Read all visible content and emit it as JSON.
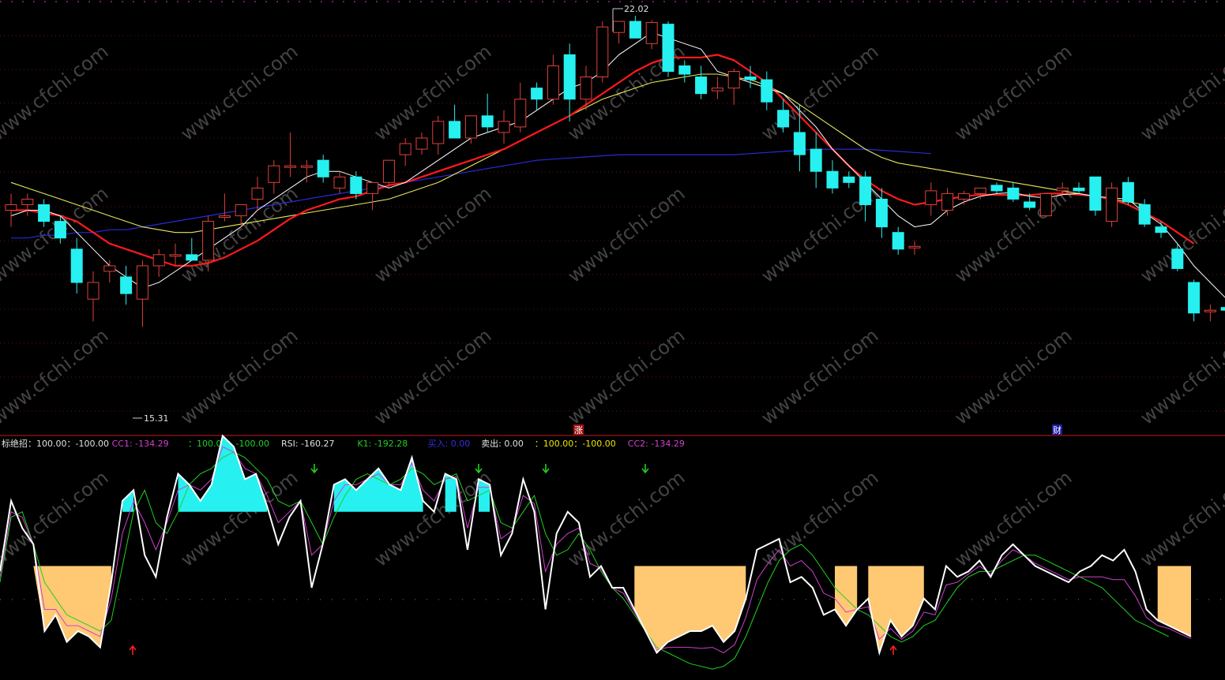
{
  "colors": {
    "up": "#e0403a",
    "down": "#26f0f0",
    "ma5": "#ffffff",
    "ma10": "#ff1a1a",
    "ma20": "#e8e85a",
    "ma60": "#2a2ad8",
    "grid": "#6a0f0f",
    "separator": "#c01818",
    "top_border": "#d040d0",
    "buy_arrow": "#ff2020",
    "sell_arrow": "#20d020",
    "cyan_fill": "#26f0f0",
    "orange_fill": "#ffc873",
    "rsi_line": "#ffffff",
    "k1_line": "#20d020",
    "cc_line": "#d040d0"
  },
  "watermark": "www.cfchi.com",
  "markers": {
    "high_label": "22.02",
    "low_label": "15.31",
    "zhang_badge": "涨",
    "cai_badge": "财"
  },
  "indicator_header": [
    {
      "text": "标绝招：100.00：-100.00",
      "color": "#e0e0e0"
    },
    {
      "text": "CC1: -134.29",
      "color": "#d040d0"
    },
    {
      "text": "：100.00：-100.00",
      "color": "#20d020"
    },
    {
      "text": "RSI: -160.27",
      "color": "#e0e0e0"
    },
    {
      "text": "K1: -192.28",
      "color": "#20d020"
    },
    {
      "text": "买入: 0.00",
      "color": "#3030e0"
    },
    {
      "text": "卖出: 0.00",
      "color": "#e0e0e0"
    },
    {
      "text": "：100.00：-100.00",
      "color": "#e8e800"
    },
    {
      "text": "CC2: -134.29",
      "color": "#d040d0"
    }
  ],
  "chart_data": [
    {
      "type": "candlestick",
      "title": "",
      "ylim": [
        15.0,
        22.3
      ],
      "candles": [
        {
          "o": 18.6,
          "h": 18.9,
          "l": 18.3,
          "c": 18.7
        },
        {
          "o": 18.7,
          "h": 18.9,
          "l": 18.5,
          "c": 18.8
        },
        {
          "o": 18.7,
          "h": 18.8,
          "l": 18.3,
          "c": 18.4
        },
        {
          "o": 18.4,
          "h": 18.5,
          "l": 18.0,
          "c": 18.1
        },
        {
          "o": 17.9,
          "h": 18.1,
          "l": 17.1,
          "c": 17.3
        },
        {
          "o": 17.0,
          "h": 17.5,
          "l": 16.6,
          "c": 17.3
        },
        {
          "o": 17.5,
          "h": 17.7,
          "l": 17.3,
          "c": 17.6
        },
        {
          "o": 17.4,
          "h": 17.6,
          "l": 16.9,
          "c": 17.1
        },
        {
          "o": 17.0,
          "h": 17.7,
          "l": 16.5,
          "c": 17.6
        },
        {
          "o": 17.6,
          "h": 17.9,
          "l": 17.4,
          "c": 17.8
        },
        {
          "o": 17.8,
          "h": 18.0,
          "l": 17.6,
          "c": 17.8
        },
        {
          "o": 17.8,
          "h": 18.1,
          "l": 17.7,
          "c": 17.7
        },
        {
          "o": 17.7,
          "h": 18.5,
          "l": 17.5,
          "c": 18.4
        },
        {
          "o": 18.5,
          "h": 18.9,
          "l": 18.4,
          "c": 18.5
        },
        {
          "o": 18.5,
          "h": 18.7,
          "l": 18.3,
          "c": 18.7
        },
        {
          "o": 18.8,
          "h": 19.2,
          "l": 18.6,
          "c": 19.0
        },
        {
          "o": 19.1,
          "h": 19.5,
          "l": 18.9,
          "c": 19.4
        },
        {
          "o": 19.4,
          "h": 20.0,
          "l": 19.2,
          "c": 19.4
        },
        {
          "o": 19.4,
          "h": 19.5,
          "l": 19.1,
          "c": 19.4
        },
        {
          "o": 19.5,
          "h": 19.6,
          "l": 19.1,
          "c": 19.2
        },
        {
          "o": 19.0,
          "h": 19.3,
          "l": 18.9,
          "c": 19.2
        },
        {
          "o": 19.2,
          "h": 19.3,
          "l": 18.8,
          "c": 18.9
        },
        {
          "o": 18.9,
          "h": 19.0,
          "l": 18.6,
          "c": 19.1
        },
        {
          "o": 19.1,
          "h": 19.5,
          "l": 19.0,
          "c": 19.5
        },
        {
          "o": 19.6,
          "h": 19.9,
          "l": 19.4,
          "c": 19.8
        },
        {
          "o": 19.7,
          "h": 20.0,
          "l": 19.6,
          "c": 19.9
        },
        {
          "o": 19.8,
          "h": 20.3,
          "l": 19.6,
          "c": 20.2
        },
        {
          "o": 20.2,
          "h": 20.5,
          "l": 19.9,
          "c": 19.9
        },
        {
          "o": 19.9,
          "h": 20.3,
          "l": 19.8,
          "c": 20.3
        },
        {
          "o": 20.3,
          "h": 20.7,
          "l": 20.0,
          "c": 20.1
        },
        {
          "o": 20.0,
          "h": 20.4,
          "l": 19.8,
          "c": 20.2
        },
        {
          "o": 20.1,
          "h": 20.9,
          "l": 20.0,
          "c": 20.6
        },
        {
          "o": 20.8,
          "h": 20.9,
          "l": 20.4,
          "c": 20.6
        },
        {
          "o": 20.6,
          "h": 21.4,
          "l": 20.5,
          "c": 21.2
        },
        {
          "o": 21.4,
          "h": 21.6,
          "l": 20.2,
          "c": 20.6
        },
        {
          "o": 20.6,
          "h": 21.2,
          "l": 20.4,
          "c": 21.0
        },
        {
          "o": 21.0,
          "h": 22.0,
          "l": 20.9,
          "c": 21.9
        },
        {
          "o": 21.8,
          "h": 22.0,
          "l": 21.6,
          "c": 22.0
        },
        {
          "o": 22.0,
          "h": 22.1,
          "l": 21.9,
          "c": 21.7
        },
        {
          "o": 21.6,
          "h": 22.02,
          "l": 21.5,
          "c": 21.98
        },
        {
          "o": 21.95,
          "h": 22.0,
          "l": 21.0,
          "c": 21.1
        },
        {
          "o": 21.2,
          "h": 21.3,
          "l": 20.9,
          "c": 21.05
        },
        {
          "o": 21.0,
          "h": 21.2,
          "l": 20.6,
          "c": 20.7
        },
        {
          "o": 20.75,
          "h": 21.0,
          "l": 20.6,
          "c": 20.8
        },
        {
          "o": 20.8,
          "h": 21.15,
          "l": 20.5,
          "c": 21.1
        },
        {
          "o": 21.0,
          "h": 21.2,
          "l": 20.8,
          "c": 20.95
        },
        {
          "o": 20.95,
          "h": 21.1,
          "l": 20.4,
          "c": 20.55
        },
        {
          "o": 20.4,
          "h": 20.6,
          "l": 20.0,
          "c": 20.1
        },
        {
          "o": 20.0,
          "h": 20.5,
          "l": 19.3,
          "c": 19.6
        },
        {
          "o": 19.7,
          "h": 20.0,
          "l": 19.0,
          "c": 19.3
        },
        {
          "o": 19.3,
          "h": 19.5,
          "l": 18.9,
          "c": 19.0
        },
        {
          "o": 19.2,
          "h": 19.3,
          "l": 19.0,
          "c": 19.1
        },
        {
          "o": 19.2,
          "h": 19.3,
          "l": 18.4,
          "c": 18.7
        },
        {
          "o": 18.8,
          "h": 19.0,
          "l": 18.1,
          "c": 18.3
        },
        {
          "o": 18.2,
          "h": 18.3,
          "l": 17.8,
          "c": 17.9
        },
        {
          "o": 17.95,
          "h": 18.05,
          "l": 17.8,
          "c": 17.95
        },
        {
          "o": 18.7,
          "h": 19.1,
          "l": 18.5,
          "c": 18.95
        },
        {
          "o": 18.6,
          "h": 19.0,
          "l": 18.5,
          "c": 18.9
        },
        {
          "o": 18.8,
          "h": 18.95,
          "l": 18.7,
          "c": 18.9
        },
        {
          "o": 18.9,
          "h": 19.0,
          "l": 18.8,
          "c": 19.0
        },
        {
          "o": 19.05,
          "h": 19.1,
          "l": 18.9,
          "c": 18.95
        },
        {
          "o": 19.0,
          "h": 19.1,
          "l": 18.75,
          "c": 18.8
        },
        {
          "o": 18.75,
          "h": 18.9,
          "l": 18.6,
          "c": 18.65
        },
        {
          "o": 18.5,
          "h": 18.9,
          "l": 18.5,
          "c": 18.9
        },
        {
          "o": 18.95,
          "h": 19.1,
          "l": 18.9,
          "c": 19.0
        },
        {
          "o": 19.0,
          "h": 19.1,
          "l": 18.9,
          "c": 18.95
        },
        {
          "o": 19.2,
          "h": 19.2,
          "l": 18.5,
          "c": 18.6
        },
        {
          "o": 18.4,
          "h": 19.1,
          "l": 18.3,
          "c": 19.0
        },
        {
          "o": 19.1,
          "h": 19.2,
          "l": 18.7,
          "c": 18.75
        },
        {
          "o": 18.7,
          "h": 18.8,
          "l": 18.3,
          "c": 18.35
        },
        {
          "o": 18.3,
          "h": 18.4,
          "l": 18.1,
          "c": 18.2
        },
        {
          "o": 17.9,
          "h": 18.0,
          "l": 17.5,
          "c": 17.55
        },
        {
          "o": 17.3,
          "h": 17.35,
          "l": 16.6,
          "c": 16.75
        },
        {
          "o": 16.8,
          "h": 16.9,
          "l": 16.6,
          "c": 16.8
        },
        {
          "o": 16.85,
          "h": 16.9,
          "l": 16.75,
          "c": 16.8
        }
      ],
      "ma5": [
        18.5,
        18.6,
        18.6,
        18.5,
        18.2,
        17.9,
        17.6,
        17.4,
        17.2,
        17.3,
        17.5,
        17.7,
        17.9,
        18.1,
        18.3,
        18.6,
        18.8,
        19.0,
        19.2,
        19.3,
        19.3,
        19.2,
        19.1,
        19.0,
        19.1,
        19.3,
        19.5,
        19.7,
        19.9,
        20.0,
        20.1,
        20.2,
        20.4,
        20.6,
        20.8,
        20.9,
        21.1,
        21.4,
        21.6,
        21.8,
        21.7,
        21.6,
        21.5,
        21.1,
        21.0,
        20.9,
        20.8,
        20.7,
        20.4,
        20.1,
        19.7,
        19.4,
        19.1,
        18.8,
        18.5,
        18.3,
        18.35,
        18.6,
        18.75,
        18.85,
        18.9,
        18.92,
        18.85,
        18.82,
        18.88,
        18.9,
        18.85,
        18.82,
        18.8,
        18.55,
        18.35,
        18.0,
        17.6,
        17.3,
        17.0
      ],
      "ma10": [
        18.6,
        18.6,
        18.55,
        18.5,
        18.4,
        18.2,
        18.0,
        17.9,
        17.8,
        17.7,
        17.6,
        17.6,
        17.65,
        17.75,
        17.9,
        18.05,
        18.25,
        18.45,
        18.6,
        18.7,
        18.8,
        18.85,
        18.95,
        19.05,
        19.1,
        19.2,
        19.3,
        19.4,
        19.5,
        19.6,
        19.7,
        19.85,
        20.0,
        20.15,
        20.3,
        20.5,
        20.7,
        20.9,
        21.1,
        21.25,
        21.35,
        21.35,
        21.35,
        21.4,
        21.3,
        21.1,
        20.9,
        20.6,
        20.3,
        20.0,
        19.7,
        19.4,
        19.15,
        18.95,
        18.8,
        18.7,
        18.75,
        18.8,
        18.85,
        18.88,
        18.88,
        18.87,
        18.87,
        18.9,
        18.9,
        18.88,
        18.85,
        18.8,
        18.7,
        18.55,
        18.4,
        18.2,
        18.0
      ],
      "ma20": [
        19.1,
        19.0,
        18.9,
        18.8,
        18.7,
        18.6,
        18.5,
        18.4,
        18.3,
        18.25,
        18.2,
        18.2,
        18.25,
        18.3,
        18.35,
        18.4,
        18.45,
        18.5,
        18.55,
        18.6,
        18.65,
        18.7,
        18.75,
        18.8,
        18.9,
        19.0,
        19.1,
        19.25,
        19.4,
        19.55,
        19.7,
        19.85,
        20.0,
        20.15,
        20.3,
        20.45,
        20.6,
        20.7,
        20.8,
        20.9,
        20.95,
        21.0,
        21.05,
        21.05,
        21.0,
        20.95,
        20.85,
        20.7,
        20.5,
        20.3,
        20.1,
        19.9,
        19.7,
        19.55,
        19.45,
        19.4,
        19.35,
        19.3,
        19.25,
        19.2,
        19.15,
        19.1,
        19.05,
        19.0,
        18.95,
        18.9,
        18.85,
        18.8,
        18.75,
        18.7
      ],
      "ma60": [
        18.1,
        18.1,
        18.15,
        18.15,
        18.2,
        18.2,
        18.25,
        18.25,
        18.3,
        18.35,
        18.4,
        18.45,
        18.5,
        18.55,
        18.6,
        18.65,
        18.7,
        18.75,
        18.8,
        18.85,
        18.9,
        18.95,
        19.0,
        19.05,
        19.1,
        19.15,
        19.2,
        19.25,
        19.3,
        19.35,
        19.4,
        19.45,
        19.5,
        19.52,
        19.54,
        19.56,
        19.58,
        19.6,
        19.6,
        19.6,
        19.6,
        19.6,
        19.6,
        19.6,
        19.6,
        19.62,
        19.64,
        19.66,
        19.68,
        19.7,
        19.7,
        19.7,
        19.7,
        19.68,
        19.66,
        19.64,
        19.62
      ]
    },
    {
      "type": "line",
      "title": "",
      "ylim": [
        -200,
        200
      ],
      "series": [
        {
          "name": "RSI",
          "values": [
            -10,
            120,
            70,
            40,
            -120,
            -90,
            -140,
            -120,
            -130,
            -150,
            -30,
            120,
            140,
            20,
            -20,
            90,
            170,
            150,
            120,
            150,
            240,
            220,
            160,
            170,
            110,
            40,
            90,
            120,
            -40,
            40,
            150,
            160,
            140,
            160,
            180,
            150,
            140,
            200,
            120,
            100,
            170,
            160,
            30,
            160,
            150,
            20,
            60,
            160,
            100,
            -80,
            60,
            100,
            80,
            -20,
            0,
            -40,
            -40,
            -80,
            -120,
            -160,
            -140,
            -130,
            -120,
            -120,
            -110,
            -140,
            -120,
            -60,
            30,
            40,
            50,
            -30,
            -20,
            -40,
            -90,
            -80,
            -110,
            -80,
            -60,
            -160,
            -100,
            -130,
            -110,
            -60,
            -80,
            0,
            -20,
            -10,
            10,
            -20,
            20,
            40,
            20,
            0,
            -10,
            -20,
            -30,
            -10,
            0,
            20,
            10,
            30,
            -10,
            -80,
            -100,
            -110,
            -120,
            -130
          ]
        },
        {
          "name": "K1",
          "values": [
            -30,
            90,
            100,
            40,
            -30,
            -60,
            -90,
            -100,
            -110,
            -120,
            -100,
            0,
            100,
            140,
            80,
            60,
            100,
            150,
            170,
            180,
            200,
            210,
            200,
            180,
            160,
            120,
            110,
            120,
            80,
            40,
            90,
            130,
            160,
            170,
            160,
            150,
            160,
            180,
            170,
            150,
            160,
            170,
            120,
            130,
            140,
            80,
            70,
            100,
            130,
            60,
            20,
            30,
            60,
            30,
            -10,
            -40,
            -60,
            -90,
            -120,
            -150,
            -160,
            -170,
            -180,
            -185,
            -190,
            -185,
            -170,
            -130,
            -80,
            -30,
            10,
            30,
            40,
            20,
            -10,
            -40,
            -60,
            -80,
            -90,
            -110,
            -130,
            -140,
            -130,
            -110,
            -100,
            -70,
            -40,
            -20,
            -10,
            -10,
            0,
            10,
            20,
            20,
            10,
            0,
            -10,
            -20,
            -30,
            -40,
            -60,
            -80,
            -100,
            -110,
            -120,
            -130
          ]
        },
        {
          "name": "CC1",
          "values": [
            -20,
            100,
            90,
            40,
            -80,
            -80,
            -110,
            -110,
            -120,
            -130,
            -60,
            60,
            120,
            80,
            30,
            80,
            140,
            150,
            140,
            160,
            220,
            210,
            180,
            170,
            130,
            80,
            100,
            120,
            20,
            40,
            120,
            150,
            150,
            160,
            170,
            150,
            150,
            190,
            140,
            120,
            160,
            165,
            70,
            145,
            145,
            50,
            65,
            130,
            115,
            -10,
            40,
            60,
            70,
            5,
            -5,
            -40,
            -50,
            -85,
            -120,
            -155,
            -150,
            -150,
            -150,
            -152,
            -150,
            -160,
            -145,
            -95,
            -25,
            5,
            30,
            0,
            10,
            -10,
            -50,
            -60,
            -85,
            -80,
            -75,
            -135,
            -115,
            -135,
            -120,
            -85,
            -90,
            -35,
            -30,
            -15,
            0,
            -15,
            10,
            30,
            20,
            5,
            -5,
            -15,
            -25,
            -20,
            -20,
            -20,
            -25,
            -25,
            -55,
            -95,
            -110,
            -115,
            -125,
            -134
          ]
        }
      ],
      "levels": [
        100,
        -100
      ],
      "buy_signals": [
        7,
        55
      ],
      "sell_signals": [
        18,
        29,
        33,
        39
      ]
    }
  ]
}
